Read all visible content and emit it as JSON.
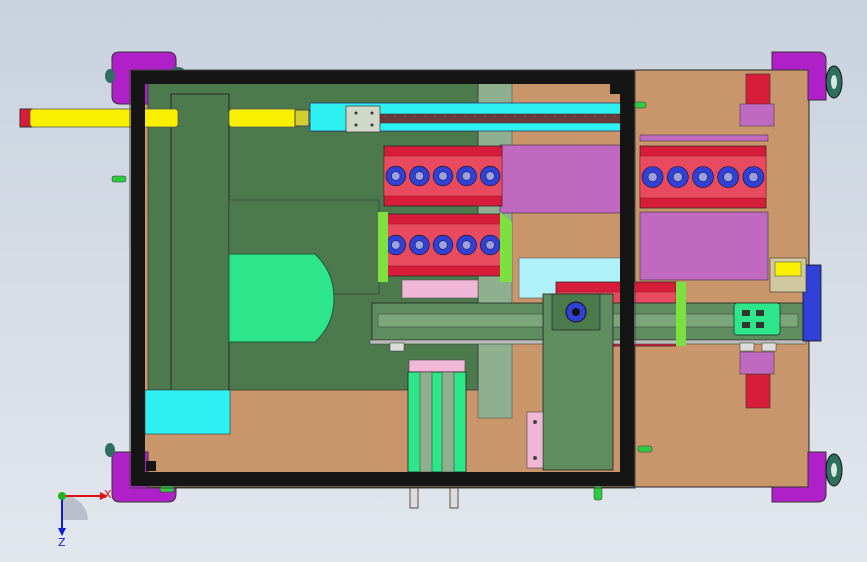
{
  "viewport": {
    "title": ""
  },
  "triad": {
    "x_label": "X",
    "z_label": "Z"
  },
  "colors": {
    "background_top": "#c9d2de",
    "background_bottom": "#e2e7ee",
    "frame": "#151515",
    "base_plate": "#c9956b",
    "dark_green": "#4d7a4d",
    "mid_green": "#5f8d5f",
    "sage": "#8fb08f",
    "bright_green": "#2ee68a",
    "cyan": "#2ef2f2",
    "light_cyan": "#b0f0f8",
    "magenta": "#c069c0",
    "purple": "#b020c8",
    "pink": "#f0b8d6",
    "red": "#d81d3a",
    "blue": "#3040d8",
    "yellow": "#f8f000",
    "lime": "#7ce040",
    "grey": "#bbbbbb"
  },
  "icons": {
    "caster_wheel": "caster-wheel-icon",
    "bolt": "bolt-icon",
    "rotary_unit": "rotary-unit-icon"
  }
}
